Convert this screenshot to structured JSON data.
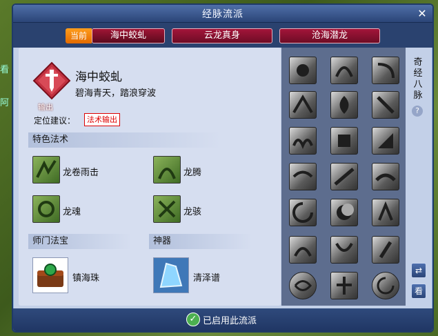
{
  "window": {
    "title": "经脉流派",
    "close_icon": "close-icon"
  },
  "tabs": [
    {
      "label": "海中蛟虬",
      "active": true
    },
    {
      "label": "云龙真身",
      "active": false
    },
    {
      "label": "沧海潜龙",
      "active": false
    }
  ],
  "current_badge": "当前",
  "hero": {
    "name": "海中蛟虬",
    "desc": "碧海青天，踏浪穿波",
    "tag": "输出",
    "icon": "sword-diamond-icon"
  },
  "positioning": {
    "label": "定位建议：",
    "value": "法术输出"
  },
  "sections": {
    "special_spells": "特色法术",
    "sect_treasure": "师门法宝",
    "artifact": "神器"
  },
  "skills": [
    {
      "name": "龙卷雨击",
      "icon": "dragon-storm-icon"
    },
    {
      "name": "龙腾",
      "icon": "dragon-rise-icon"
    },
    {
      "name": "龙魂",
      "icon": "dragon-soul-icon"
    },
    {
      "name": "龙骇",
      "icon": "dragon-terror-icon"
    }
  ],
  "treasure": {
    "name": "镇海珠",
    "icon": "pearl-chest-icon"
  },
  "artifact_item": {
    "name": "清泽谱",
    "icon": "crystal-score-icon"
  },
  "side": {
    "title": "奇经八脉",
    "help": "?",
    "swap": "⇄",
    "view": "看"
  },
  "status": "已启用此流派",
  "colors": {
    "accent": "#a3153a",
    "badge": "#ff8a00",
    "panel": "#d6def0",
    "titlebar": "#2b4577"
  }
}
